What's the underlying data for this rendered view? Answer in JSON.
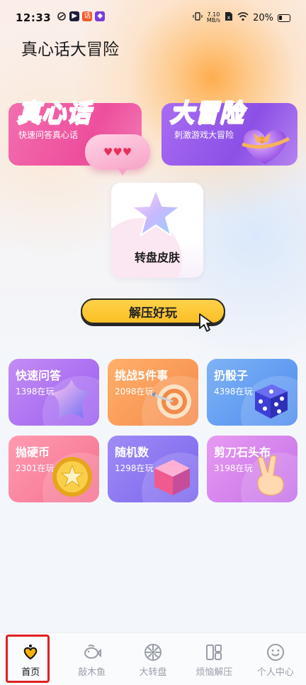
{
  "status_bar": {
    "time": "12:33",
    "net_speed_value": "7.10",
    "net_speed_unit": "MB/s",
    "battery": "20%",
    "app_icons": [
      "sync-icon",
      "play-app-icon",
      "app-icon-orange",
      "app-icon-purple"
    ]
  },
  "app": {
    "title": "真心话大冒险"
  },
  "hero": {
    "truth": {
      "title": "真心话",
      "subtitle": "快速问答真心话",
      "bubble": "♥♥♥"
    },
    "dare": {
      "title": "大冒险",
      "subtitle": "刺激游戏大冒险"
    }
  },
  "skin": {
    "label": "转盘皮肤"
  },
  "decompress_button": {
    "label": "解压好玩"
  },
  "games": [
    {
      "name": "快速问答",
      "count": "1398在玩",
      "color_from": "#c48cf5",
      "color_to": "#9a5ef0",
      "icon": "star-blob-icon"
    },
    {
      "name": "挑战5件事",
      "count": "2098在玩",
      "color_from": "#ffb06a",
      "color_to": "#f58a4b",
      "icon": "target-dart-icon"
    },
    {
      "name": "扔骰子",
      "count": "4398在玩",
      "color_from": "#7fb3f5",
      "color_to": "#4f8cf0",
      "icon": "dice-icon"
    },
    {
      "name": "抛硬币",
      "count": "2301在玩",
      "color_from": "#ff9bb0",
      "color_to": "#f47190",
      "icon": "coin-icon"
    },
    {
      "name": "随机数",
      "count": "1298在玩",
      "color_from": "#a08cf5",
      "color_to": "#7a64ee",
      "icon": "cube-icon"
    },
    {
      "name": "剪刀石头布",
      "count": "3198在玩",
      "color_from": "#e79af2",
      "color_to": "#c471e8",
      "icon": "victory-hand-icon"
    }
  ],
  "nav": [
    {
      "label": "首页",
      "icon": "home-heart-icon",
      "active": true
    },
    {
      "label": "敲木鱼",
      "icon": "wooden-fish-icon",
      "active": false
    },
    {
      "label": "大转盘",
      "icon": "wheel-icon",
      "active": false
    },
    {
      "label": "烦恼解压",
      "icon": "layout-icon",
      "active": false
    },
    {
      "label": "个人中心",
      "icon": "smiley-icon",
      "active": false
    }
  ]
}
